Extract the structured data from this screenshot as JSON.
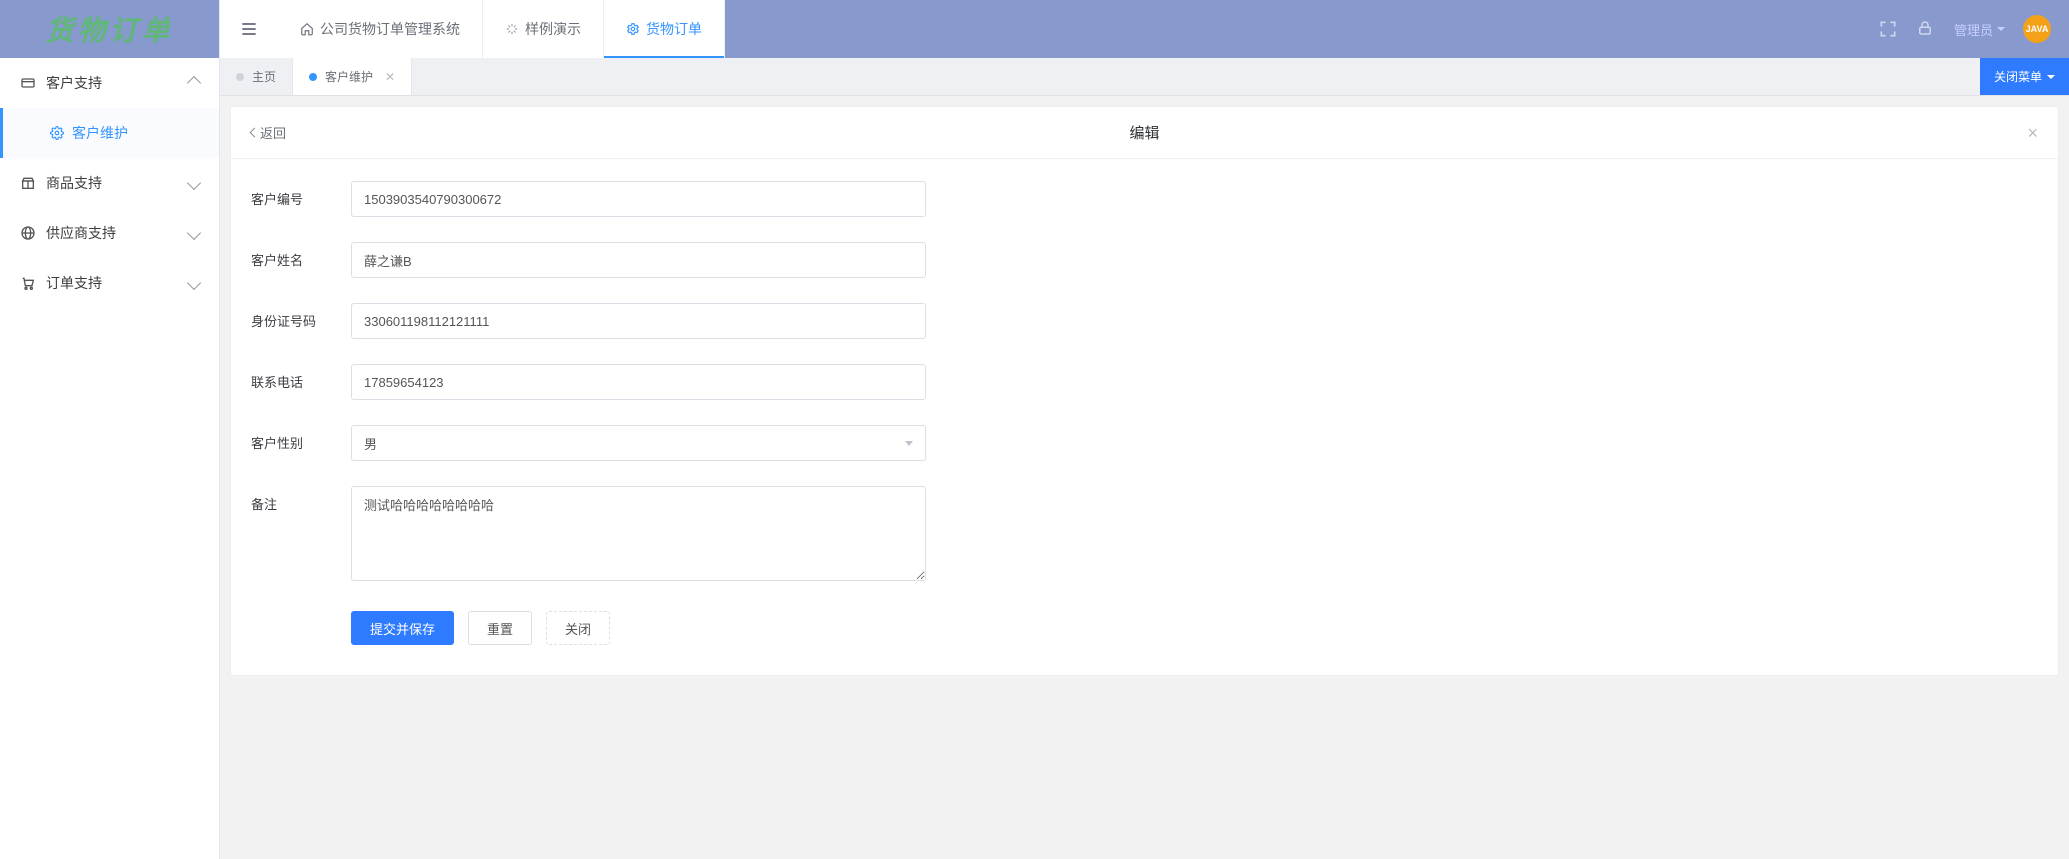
{
  "brand": {
    "title": "货物订单"
  },
  "sidebar": {
    "items": [
      {
        "label": "客户支持"
      },
      {
        "label": "商品支持"
      },
      {
        "label": "供应商支持"
      },
      {
        "label": "订单支持"
      }
    ],
    "customer_sub": {
      "maintain": "客户维护"
    }
  },
  "topnav": {
    "system": "公司货物订单管理系统",
    "demo": "样例演示",
    "orders": "货物订单"
  },
  "topright": {
    "user_label": "管理员",
    "avatar_text": "JAVA"
  },
  "tabs": {
    "home": "主页",
    "customer_maintain": "客户维护",
    "close_menu": "关闭菜单"
  },
  "panel": {
    "back": "返回",
    "title": "编辑"
  },
  "form": {
    "labels": {
      "code": "客户编号",
      "name": "客户姓名",
      "idcard": "身份证号码",
      "phone": "联系电话",
      "gender": "客户性别",
      "remark": "备注"
    },
    "values": {
      "code": "1503903540790300672",
      "name": "薛之谦B",
      "idcard": "330601198112121111",
      "phone": "17859654123",
      "gender": "男",
      "remark": "测试哈哈哈哈哈哈哈哈"
    },
    "buttons": {
      "submit": "提交并保存",
      "reset": "重置",
      "close": "关闭"
    }
  }
}
